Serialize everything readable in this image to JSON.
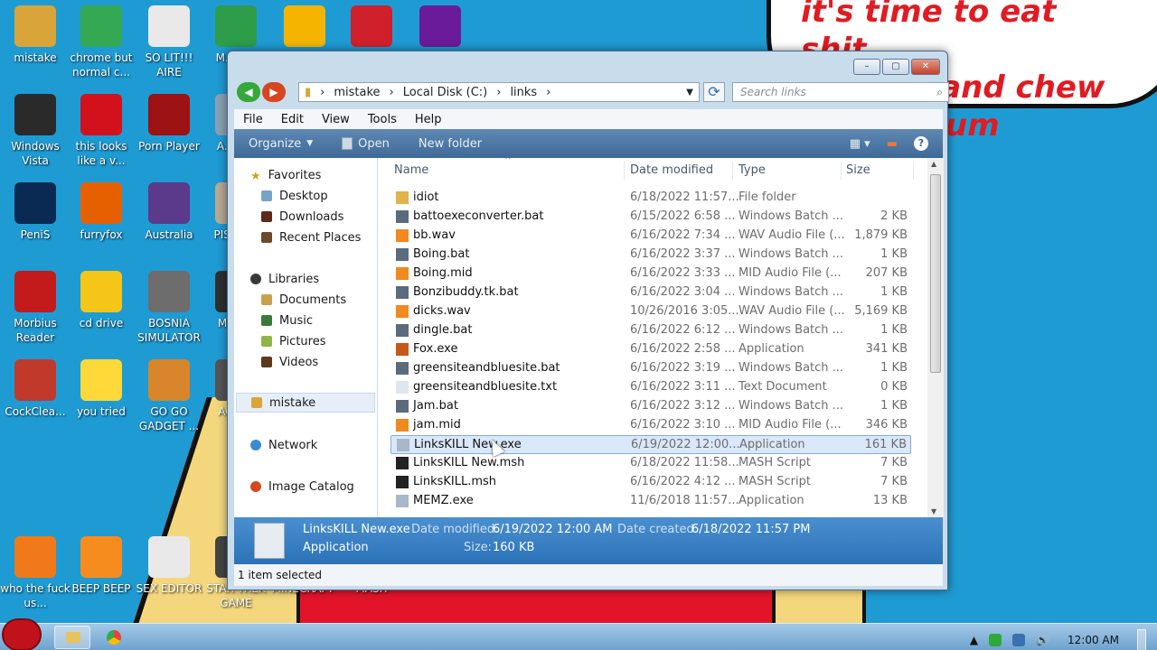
{
  "wallpaper": {
    "comic_text_line1": "it's time to eat shit",
    "comic_text_line2": "and die and chew",
    "comic_text_line3": "um"
  },
  "desktop_icons": [
    {
      "label": "mistake",
      "icon": "folder-icon",
      "color": "#d9a53a"
    },
    {
      "label": "chrome but normal c...",
      "icon": "chrome-icon",
      "color": "#34a853"
    },
    {
      "label": "SO LIT!!! AIRE",
      "icon": "cards-icon",
      "color": "#e9e9e9"
    },
    {
      "label": "M... E...",
      "icon": "shield-icon",
      "color": "#2e9d4a"
    },
    {
      "label": "",
      "icon": "pig-icon",
      "color": "#f5b400"
    },
    {
      "label": "",
      "icon": "bat-icon",
      "color": "#d0202c"
    },
    {
      "label": "",
      "icon": "yahoo-icon",
      "color": "#6a1b9a"
    },
    {
      "label": "Windows Vista",
      "icon": "trash-icon",
      "color": "#2a2a2a"
    },
    {
      "label": "this looks like a v...",
      "icon": "opera-icon",
      "color": "#d3111c"
    },
    {
      "label": "Porn Player",
      "icon": "flash-icon",
      "color": "#9d1212"
    },
    {
      "label": "A... E...",
      "icon": "app-icon",
      "color": "#8aa1b3"
    },
    {
      "label": "PeniS",
      "icon": "photoshop-icon",
      "color": "#0a2a54"
    },
    {
      "label": "furryfox",
      "icon": "firefox-icon",
      "color": "#e66000"
    },
    {
      "label": "Australia",
      "icon": "spider-icon",
      "color": "#5c3a8b"
    },
    {
      "label": "PISS AVI",
      "icon": "video-icon",
      "color": "#b8a894"
    },
    {
      "label": "Morbius Reader",
      "icon": "acrobat-icon",
      "color": "#c31b1b"
    },
    {
      "label": "cd drive",
      "icon": "cd-icon",
      "color": "#f5c518"
    },
    {
      "label": "BOSNIA SIMULATOR",
      "icon": "mine-icon",
      "color": "#6d6d6d"
    },
    {
      "label": "MA UN",
      "icon": "app-icon",
      "color": "#2f2f2f"
    },
    {
      "label": "CockClea...",
      "icon": "ccleaner-icon",
      "color": "#c0392b"
    },
    {
      "label": "you tried",
      "icon": "star-icon",
      "color": "#ffd83a"
    },
    {
      "label": "GO GO GADGET ...",
      "icon": "briefcase-icon",
      "color": "#d9852b"
    },
    {
      "label": "AG GH",
      "icon": "app-icon",
      "color": "#555"
    },
    {
      "label": "who the fuck us...",
      "icon": "bolt-icon",
      "color": "#f07a1a"
    },
    {
      "label": "BEEP BEEP",
      "icon": "vlc-icon",
      "color": "#f78c1e"
    },
    {
      "label": "SEX EDITOR",
      "icon": "hxd-icon",
      "color": "#e9e9e9"
    },
    {
      "label": "STAR TREK GAME",
      "icon": "app-icon",
      "color": "#444"
    },
    {
      "label": "MINECRAFT",
      "icon": "app-icon",
      "color": "#6b8f3a"
    },
    {
      "label": "MASH",
      "icon": "app-icon",
      "color": "#333"
    }
  ],
  "window": {
    "controls": {
      "minimize": "–",
      "maximize": "▢",
      "close": "✕"
    },
    "address": {
      "path": [
        "mistake",
        "Local Disk (C:)",
        "links"
      ]
    },
    "search": {
      "placeholder": "Search links"
    },
    "menu": [
      "File",
      "Edit",
      "View",
      "Tools",
      "Help"
    ],
    "commands": {
      "organize": "Organize",
      "open": "Open",
      "new_folder": "New folder"
    },
    "nav_pane": {
      "favorites": "Favorites",
      "desktop": "Desktop",
      "downloads": "Downloads",
      "recent": "Recent Places",
      "libraries": "Libraries",
      "documents": "Documents",
      "music": "Music",
      "pictures": "Pictures",
      "videos": "Videos",
      "mistake": "mistake",
      "network": "Network",
      "image_catalog": "Image Catalog"
    },
    "columns": {
      "name": "Name",
      "date": "Date modified",
      "type": "Type",
      "size": "Size"
    },
    "files": [
      {
        "name": "idiot",
        "date": "6/18/2022 11:57...",
        "type": "File folder",
        "size": "",
        "icon": "folder-icon"
      },
      {
        "name": "battoexeconverter.bat",
        "date": "6/15/2022 6:58 ...",
        "type": "Windows Batch ...",
        "size": "2 KB",
        "icon": "batch-icon"
      },
      {
        "name": "bb.wav",
        "date": "6/16/2022 7:34 ...",
        "type": "WAV Audio File (...",
        "size": "1,879 KB",
        "icon": "vlc-icon"
      },
      {
        "name": "Boing.bat",
        "date": "6/16/2022 3:37 ...",
        "type": "Windows Batch ...",
        "size": "1 KB",
        "icon": "batch-icon"
      },
      {
        "name": "Boing.mid",
        "date": "6/16/2022 3:33 ...",
        "type": "MID Audio File (...",
        "size": "207 KB",
        "icon": "vlc-icon"
      },
      {
        "name": "Bonzibuddy.tk.bat",
        "date": "6/16/2022 3:04 ...",
        "type": "Windows Batch ...",
        "size": "1 KB",
        "icon": "batch-icon"
      },
      {
        "name": "dicks.wav",
        "date": "10/26/2016 3:05...",
        "type": "WAV Audio File (...",
        "size": "5,169 KB",
        "icon": "vlc-icon"
      },
      {
        "name": "dingle.bat",
        "date": "6/16/2022 6:12 ...",
        "type": "Windows Batch ...",
        "size": "1 KB",
        "icon": "batch-icon"
      },
      {
        "name": "Fox.exe",
        "date": "6/16/2022 2:58 ...",
        "type": "Application",
        "size": "341 KB",
        "icon": "fox-icon"
      },
      {
        "name": "greensiteandbluesite.bat",
        "date": "6/16/2022 3:19 ...",
        "type": "Windows Batch ...",
        "size": "1 KB",
        "icon": "batch-icon"
      },
      {
        "name": "greensiteandbluesite.txt",
        "date": "6/16/2022 3:11 ...",
        "type": "Text Document",
        "size": "0 KB",
        "icon": "text-icon"
      },
      {
        "name": "Jam.bat",
        "date": "6/16/2022 3:12 ...",
        "type": "Windows Batch ...",
        "size": "1 KB",
        "icon": "batch-icon"
      },
      {
        "name": "jam.mid",
        "date": "6/16/2022 3:10 ...",
        "type": "MID Audio File (...",
        "size": "346 KB",
        "icon": "vlc-icon"
      },
      {
        "name": "LinksKILL New.exe",
        "date": "6/19/2022 12:00...",
        "type": "Application",
        "size": "161 KB",
        "icon": "app-icon",
        "selected": true
      },
      {
        "name": "LinksKILL New.msh",
        "date": "6/18/2022 11:58...",
        "type": "MASH Script",
        "size": "7 KB",
        "icon": "mash-icon"
      },
      {
        "name": "LinksKILL.msh",
        "date": "6/16/2022 4:12 ...",
        "type": "MASH Script",
        "size": "7 KB",
        "icon": "mash-icon"
      },
      {
        "name": "MEMZ.exe",
        "date": "11/6/2018 11:57...",
        "type": "Application",
        "size": "13 KB",
        "icon": "app-icon"
      }
    ],
    "details": {
      "name": "LinksKILL New.exe",
      "type": "Application",
      "date_modified_label": "Date modified:",
      "date_modified": "6/19/2022 12:00 AM",
      "date_created_label": "Date created:",
      "date_created": "6/18/2022 11:57 PM",
      "size_label": "Size:",
      "size": "160 KB"
    },
    "status": "1 item selected"
  },
  "taskbar": {
    "clock": "12:00 AM"
  }
}
